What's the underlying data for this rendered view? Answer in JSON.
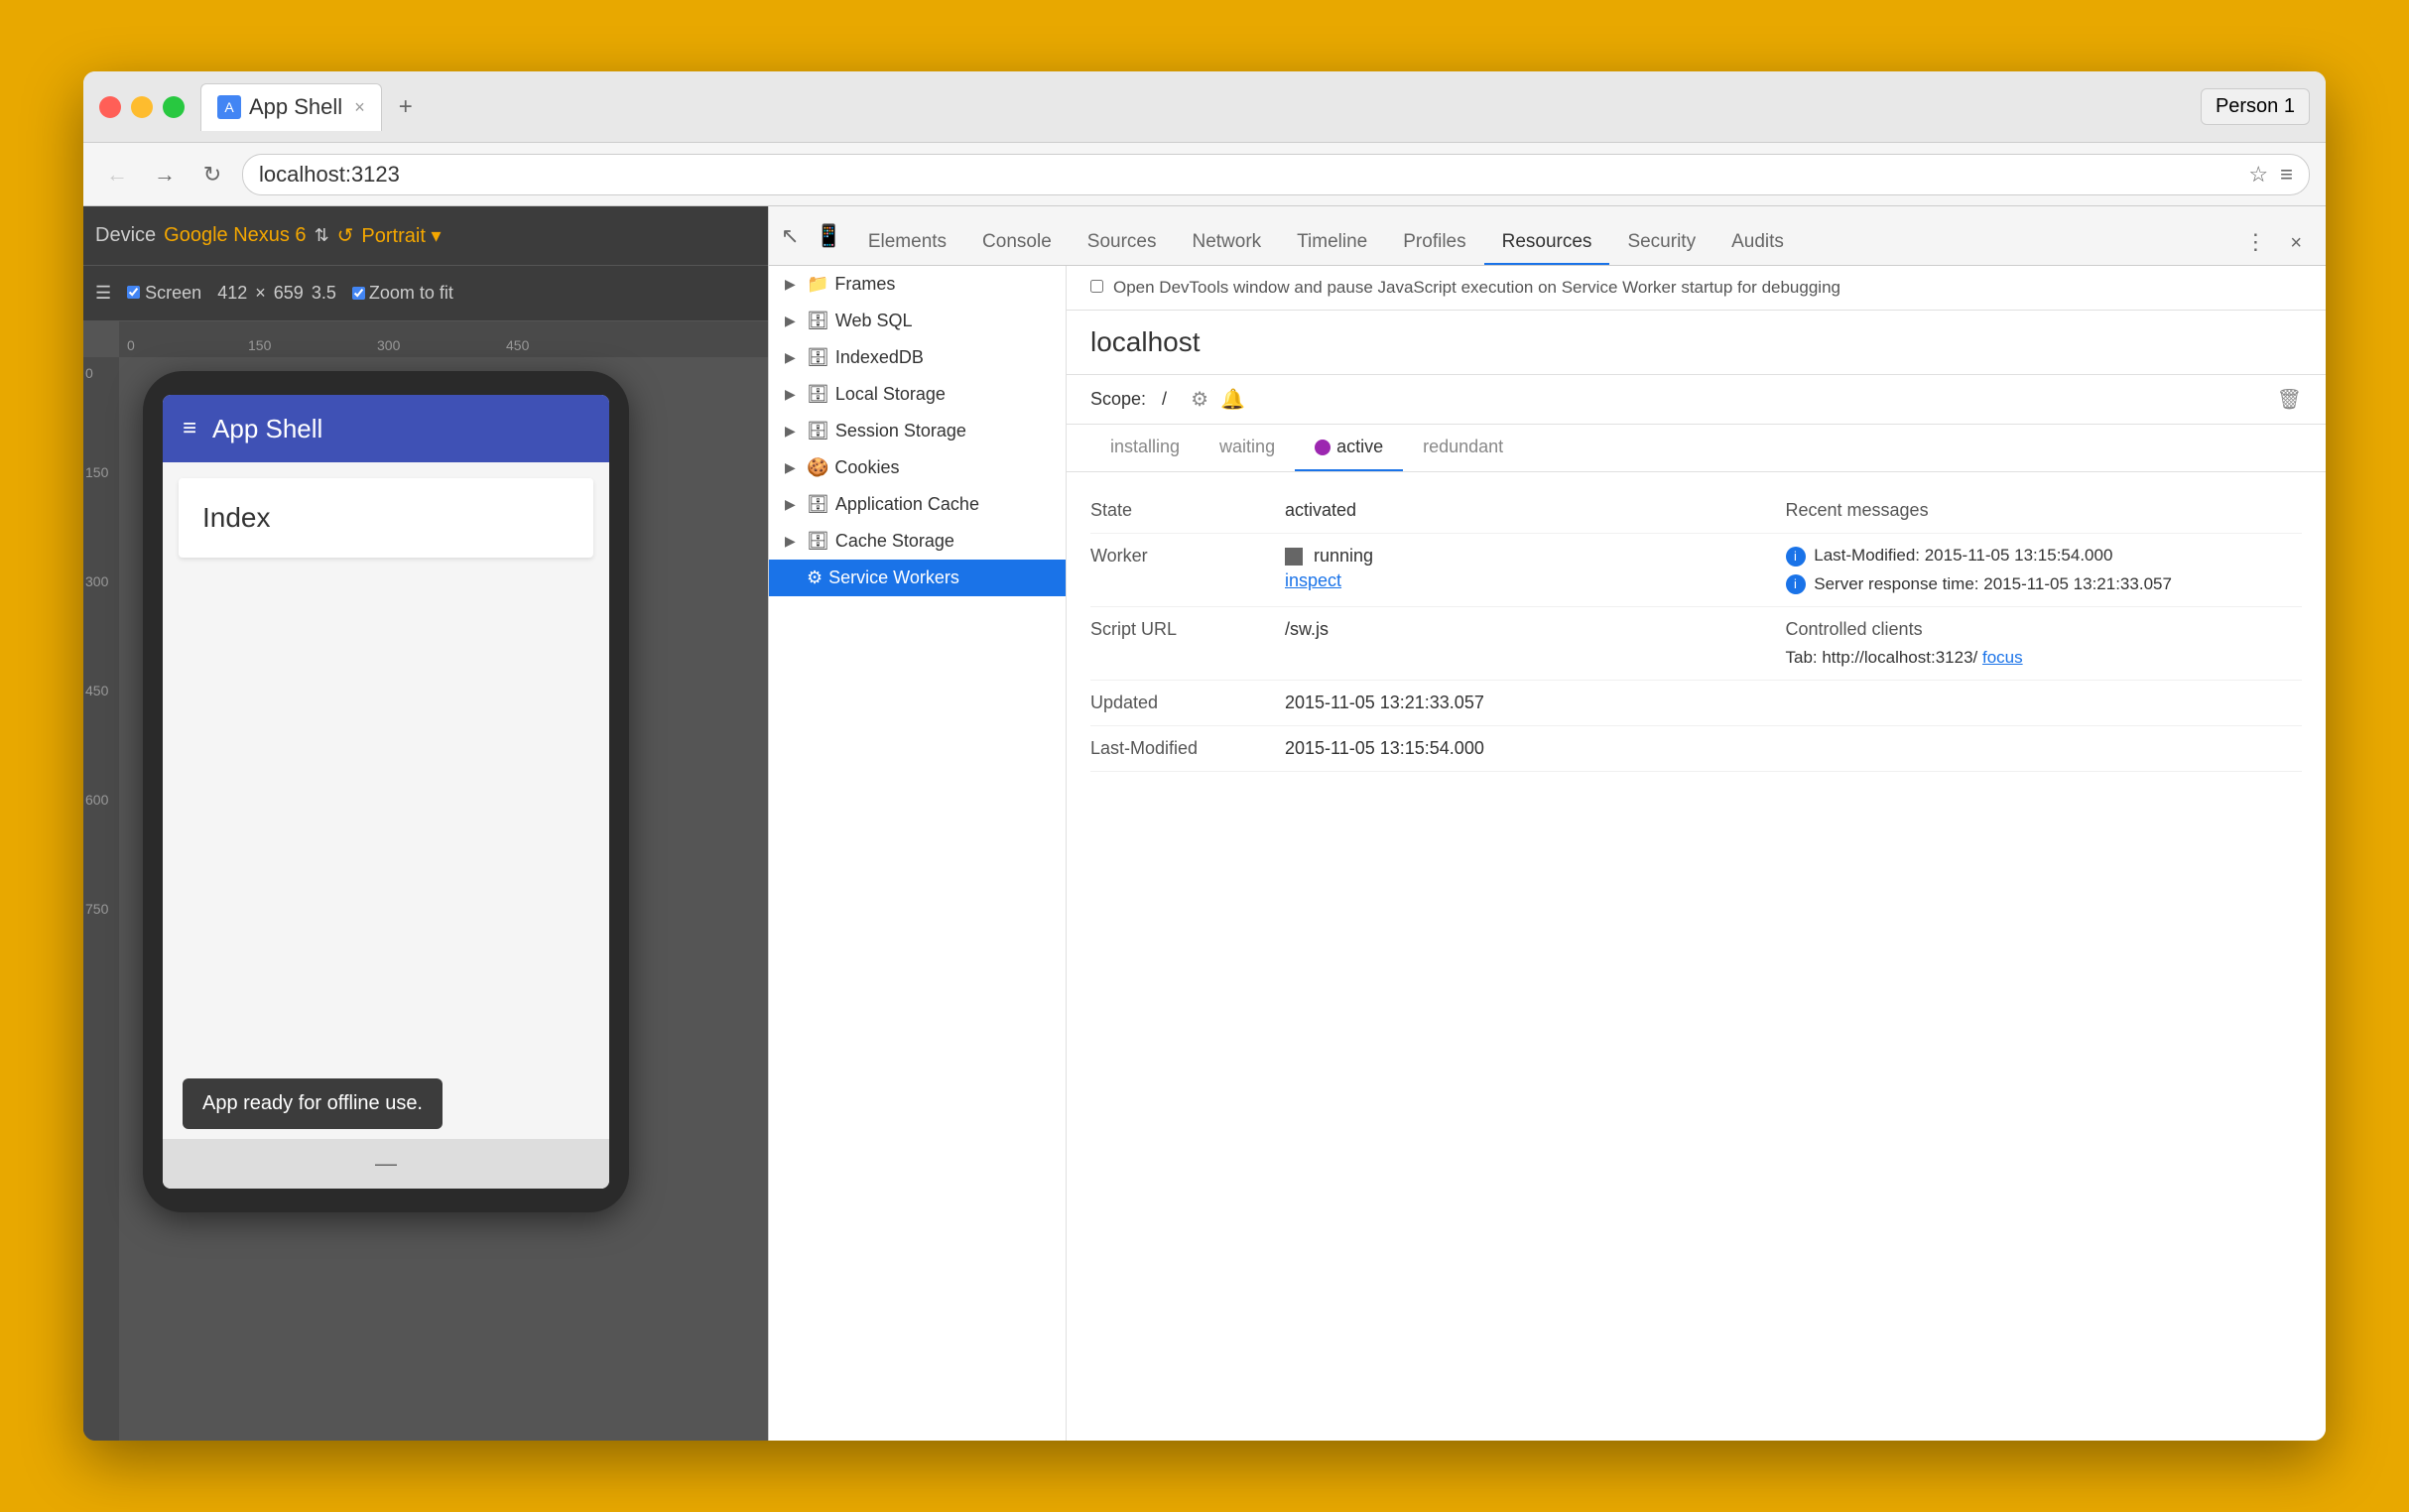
{
  "browser": {
    "tab_title": "App Shell",
    "tab_close": "×",
    "new_tab": "+",
    "profile_label": "Person 1",
    "address": "localhost:3123",
    "back_icon": "←",
    "forward_icon": "→",
    "refresh_icon": "↻",
    "bookmark_icon": "☆",
    "menu_icon": "≡"
  },
  "device_toolbar": {
    "device_label": "Device",
    "device_name": "Google Nexus 6",
    "arrows": "⇅",
    "refresh": "↺",
    "orientation": "Portrait ▾",
    "screen_label": "Screen",
    "width": "412",
    "cross": "×",
    "height": "659",
    "zoom": "3.5",
    "zoom_fit_label": "Zoom to fit",
    "ruler_marks_h": [
      "0",
      "150",
      "300",
      "450"
    ],
    "ruler_marks_v": [
      "0",
      "150",
      "300",
      "450",
      "600",
      "750"
    ]
  },
  "phone": {
    "app_title": "App Shell",
    "hamburger": "≡",
    "index_title": "Index",
    "toast": "App ready for offline use.",
    "nav_bottom": "—"
  },
  "devtools": {
    "tabs": [
      {
        "label": "Elements",
        "active": false
      },
      {
        "label": "Console",
        "active": false
      },
      {
        "label": "Sources",
        "active": false
      },
      {
        "label": "Network",
        "active": false
      },
      {
        "label": "Timeline",
        "active": false
      },
      {
        "label": "Profiles",
        "active": false
      },
      {
        "label": "Resources",
        "active": true
      },
      {
        "label": "Security",
        "active": false
      },
      {
        "label": "Audits",
        "active": false
      }
    ],
    "more_icon": "⋮",
    "close_icon": "×",
    "cursor_icon": "↖",
    "mobile_icon": "📱",
    "tree": [
      {
        "label": "Frames",
        "indent": 0,
        "icon": "📁",
        "arrow": "▶",
        "selected": false
      },
      {
        "label": "Web SQL",
        "indent": 0,
        "icon": "🗄",
        "arrow": "▶",
        "selected": false
      },
      {
        "label": "IndexedDB",
        "indent": 0,
        "icon": "🗄",
        "arrow": "▶",
        "selected": false
      },
      {
        "label": "Local Storage",
        "indent": 0,
        "icon": "🗄",
        "arrow": "▶",
        "selected": false
      },
      {
        "label": "Session Storage",
        "indent": 0,
        "icon": "🗄",
        "arrow": "▶",
        "selected": false
      },
      {
        "label": "Cookies",
        "indent": 0,
        "icon": "🍪",
        "arrow": "▶",
        "selected": false
      },
      {
        "label": "Application Cache",
        "indent": 0,
        "icon": "🗄",
        "arrow": "▶",
        "selected": false
      },
      {
        "label": "Cache Storage",
        "indent": 0,
        "icon": "🗄",
        "arrow": "▶",
        "selected": false
      },
      {
        "label": "Service Workers",
        "indent": 0,
        "icon": "⚙",
        "arrow": "",
        "selected": true
      }
    ],
    "service_worker": {
      "debug_checkbox_label": "Open DevTools window and pause JavaScript execution on Service Worker startup for debugging",
      "host": "localhost",
      "scope_label": "Scope:",
      "scope_value": "/",
      "settings_icon": "⚙",
      "bell_icon": "🔔",
      "delete_icon": "🗑",
      "status_tabs": [
        "installing",
        "waiting",
        "active",
        "redundant"
      ],
      "active_tab": "active",
      "state_label": "State",
      "state_value": "activated",
      "worker_label": "Worker",
      "worker_state": "running",
      "worker_inspect": "inspect",
      "script_url_label": "Script URL",
      "script_url_value": "/sw.js",
      "updated_label": "Updated",
      "updated_value": "2015-11-05 13:21:33.057",
      "last_modified_label": "Last-Modified",
      "last_modified_value": "2015-11-05 13:15:54.000",
      "recent_messages_label": "Recent messages",
      "message1": "Last-Modified: 2015-11-05 13:15:54.000",
      "message2": "Server response time: 2015-11-05 13:21:33.057",
      "controlled_clients_label": "Controlled clients",
      "tab_label": "Tab: http://localhost:3123/",
      "focus_link": "focus"
    }
  }
}
